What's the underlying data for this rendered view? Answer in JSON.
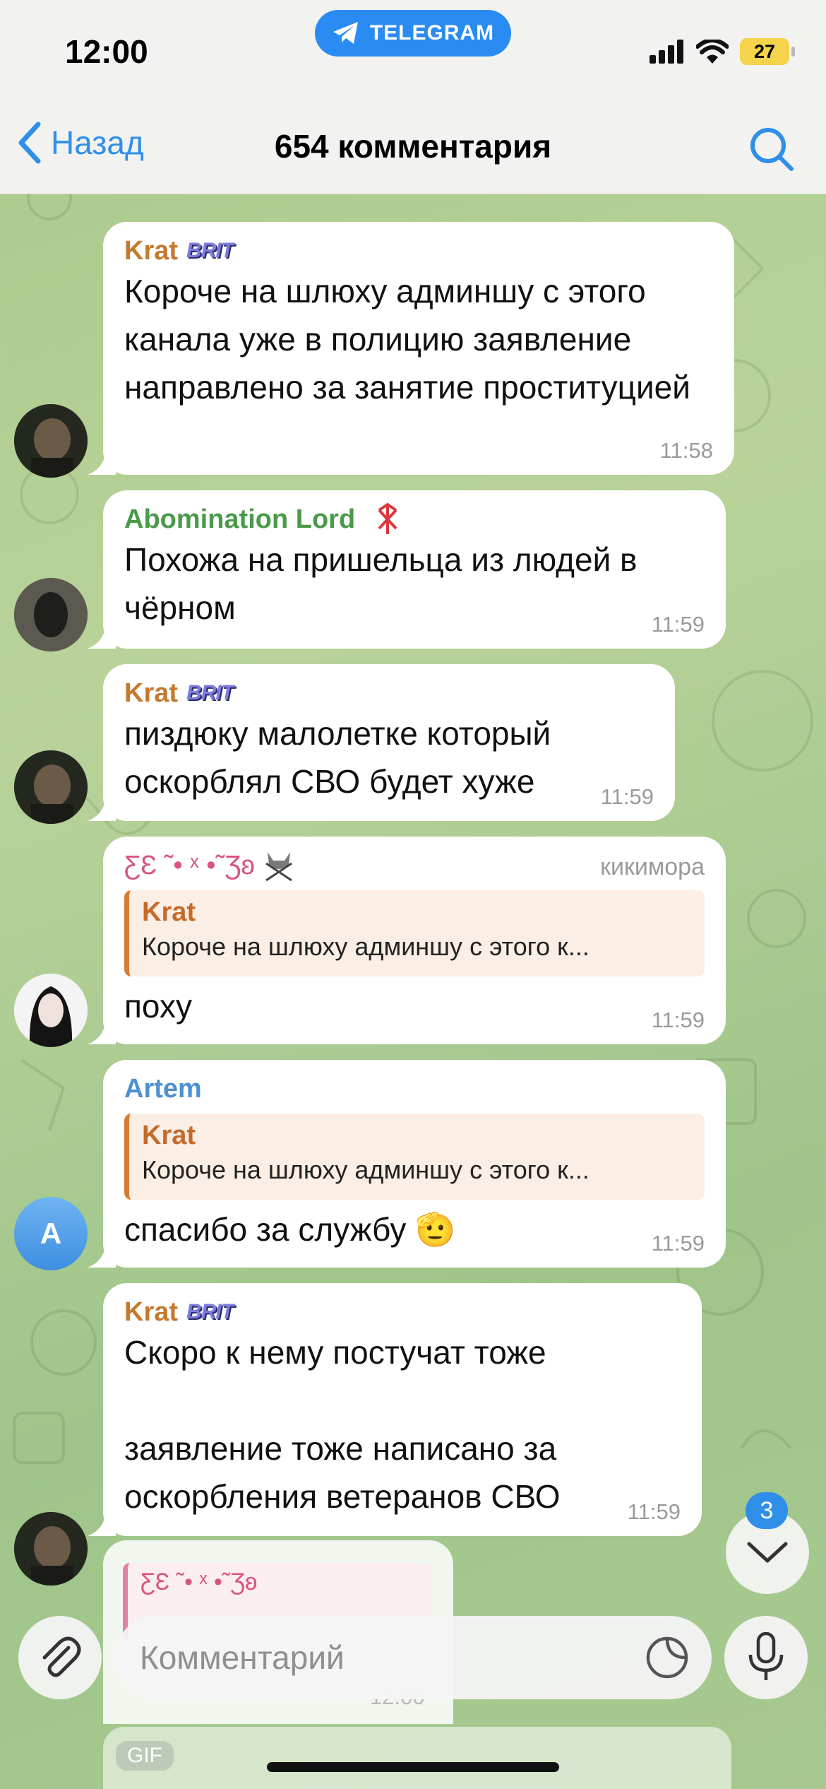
{
  "status_bar": {
    "time": "12:00",
    "app_pill": "TELEGRAM",
    "battery": "27"
  },
  "nav": {
    "back_label": "Назад",
    "title": "654 комментария"
  },
  "messages": [
    {
      "sender": "Krat",
      "sender_color": "#c5792d",
      "badge": "BRIT",
      "text": "Короче на шлюху админшу с этого канала уже в полицию заявление направлено за занятие проституцией",
      "time": "11:58"
    },
    {
      "sender": "Abomination Lord",
      "sender_color": "#4a9a4b",
      "badge_icon": "rune-icon",
      "text": "Похожа на пришельца из людей в чёрном",
      "time": "11:59"
    },
    {
      "sender": "Krat",
      "sender_color": "#c5792d",
      "badge": "BRIT",
      "text": "пиздюку малолетке который оскорблял СВО будет хуже",
      "time": "11:59"
    },
    {
      "sender": "ƸƐ ˜• ˣ •˜Ʒʚ",
      "sender_color": "#d9537f",
      "role": "кикимора",
      "reply_to": {
        "name": "Krat",
        "text": "Короче на шлюху админшу с этого к..."
      },
      "text": "поху",
      "time": "11:59"
    },
    {
      "sender": "Artem",
      "sender_color": "#4e90d1",
      "avatar_letter": "A",
      "reply_to": {
        "name": "Krat",
        "text": "Короче на шлюху админшу с этого к..."
      },
      "text": "спасибо за службу 🫡",
      "time": "11:59"
    },
    {
      "sender": "Krat",
      "sender_color": "#c5792d",
      "badge": "BRIT",
      "text_lines": [
        "Скоро к нему постучат тоже",
        "",
        "заявление тоже написано за",
        "оскорбления ветеранов СВО"
      ],
      "time": "11:59"
    }
  ],
  "partial_message": {
    "reply_name": "ƸƐ ˜• ˣ •˜Ʒʚ",
    "time": "12:00",
    "gif_label": "GIF"
  },
  "scroll_button": {
    "unread_count": "3"
  },
  "composer": {
    "placeholder": "Комментарий"
  }
}
